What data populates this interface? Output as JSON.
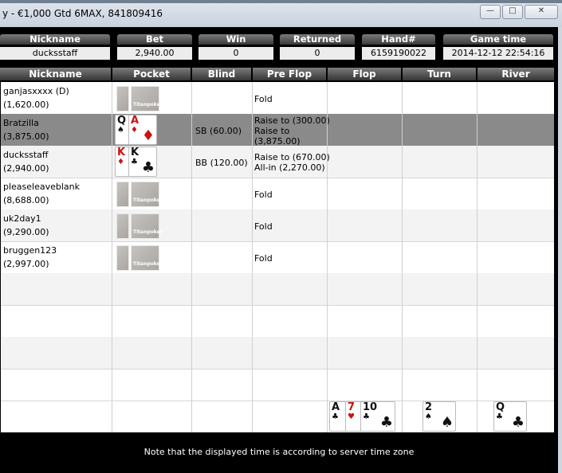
{
  "window": {
    "title": "y - €1,000 Gtd  6MAX, 841809416",
    "buttons": [
      "minimize",
      "restore",
      "close"
    ]
  },
  "summary": {
    "headers": [
      "Nickname",
      "Bet",
      "Win",
      "Returned",
      "Hand#",
      "Game time"
    ],
    "values": [
      "ducksstaff",
      "2,940.00",
      "0",
      "0",
      "6159190022",
      "2014-12-12 22:54:16"
    ]
  },
  "table": {
    "columns": [
      "Nickname",
      "Pocket",
      "Blind",
      "Pre Flop",
      "Flop",
      "Turn",
      "River"
    ],
    "rows": [
      {
        "name": "ganjasxxxx (D)",
        "stack": "(1,620.00)",
        "blind": "",
        "preflop": [
          "Fold"
        ],
        "cards": "hidden"
      },
      {
        "name": "Bratzilla",
        "stack": "(3,875.00)",
        "blind": "SB (60.00)",
        "preflop": [
          "Raise to (300.00)",
          "Raise to",
          "(3,875.00)"
        ],
        "cards": [
          "Q♠",
          "A♦"
        ]
      },
      {
        "name": "ducksstaff",
        "stack": "(2,940.00)",
        "blind": "BB (120.00)",
        "preflop": [
          "Raise to (670.00)",
          "All-in (2,270.00)"
        ],
        "cards": [
          "K♦",
          "K♣"
        ]
      },
      {
        "name": "pleaseleaveblank",
        "stack": "(8,688.00)",
        "blind": "",
        "preflop": [
          "Fold"
        ],
        "cards": "hidden"
      },
      {
        "name": "uk2day1",
        "stack": "(9,290.00)",
        "blind": "",
        "preflop": [
          "Fold"
        ],
        "cards": "hidden"
      },
      {
        "name": "bruggen123",
        "stack": "(2,997.00)",
        "blind": "",
        "preflop": [
          "Fold"
        ],
        "cards": "hidden"
      }
    ],
    "hidden_card_logo": "Titanpoker"
  },
  "board": {
    "flop": [
      {
        "rank": "A",
        "suit": "♣",
        "color": "#111111"
      },
      {
        "rank": "7",
        "suit": "♥",
        "color": "#cc1111"
      },
      {
        "rank": "10",
        "suit": "♣",
        "color": "#111111"
      }
    ],
    "turn": {
      "rank": "2",
      "suit": "♠",
      "color": "#111111"
    },
    "river": {
      "rank": "Q",
      "suit": "♣",
      "color": "#111111"
    }
  },
  "footer": {
    "note": "Note that the displayed time is according to server time zone"
  }
}
